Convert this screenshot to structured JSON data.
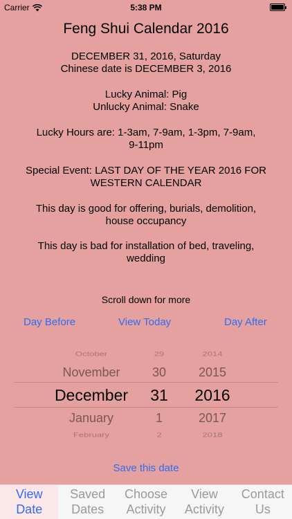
{
  "status_bar": {
    "carrier": "Carrier",
    "time": "5:38 PM"
  },
  "page_title": "Feng Shui Calendar 2016",
  "date_info": {
    "western_date": "DECEMBER 31, 2016, Saturday",
    "chinese_date": "Chinese date is DECEMBER 3, 2016",
    "lucky_animal": "Lucky Animal: Pig",
    "unlucky_animal": "Unlucky Animal: Snake",
    "lucky_hours_line1": "Lucky Hours are: 1-3am, 7-9am, 1-3pm, 7-9am,",
    "lucky_hours_line2": "9-11pm",
    "special_event_line1": "Special Event: LAST DAY OF THE YEAR 2016 FOR",
    "special_event_line2": "WESTERN CALENDAR",
    "good_for_line1": "This day is good for offering, burials, demolition,",
    "good_for_line2": "house occupancy",
    "bad_for_line1": "This day is bad for installation of bed, traveling,",
    "bad_for_line2": "wedding"
  },
  "scroll_hint": "Scroll down for more",
  "nav": {
    "day_before": "Day Before",
    "view_today": "View Today",
    "day_after": "Day After"
  },
  "picker": {
    "months": [
      "October",
      "November",
      "December",
      "January",
      "February"
    ],
    "days": [
      "29",
      "30",
      "31",
      "1",
      "2"
    ],
    "years": [
      "2014",
      "2015",
      "2016",
      "2017",
      "2018"
    ]
  },
  "save_button": "Save this date",
  "tabs": [
    {
      "line1": "View",
      "line2": "Date"
    },
    {
      "line1": "Saved",
      "line2": "Dates"
    },
    {
      "line1": "Choose",
      "line2": "Activity"
    },
    {
      "line1": "View",
      "line2": "Activity"
    },
    {
      "line1": "Contact",
      "line2": "Us"
    }
  ],
  "colors": {
    "background": "#e4a19f",
    "accent": "#2f6cf5"
  }
}
